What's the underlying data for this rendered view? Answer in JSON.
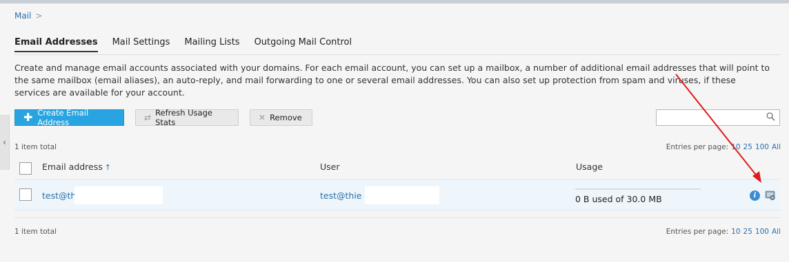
{
  "breadcrumb": {
    "root": "Mail",
    "sep": ">"
  },
  "tabs": [
    {
      "label": "Email Addresses",
      "active": true
    },
    {
      "label": "Mail Settings"
    },
    {
      "label": "Mailing Lists"
    },
    {
      "label": "Outgoing Mail Control"
    }
  ],
  "description": "Create and manage email accounts associated with your domains. For each email account, you can set up a mailbox, a number of additional email addresses that will point to the same mailbox (email aliases), an auto-reply, and mail forwarding to one or several email addresses. You can also set up protection from spam and viruses, if these services are available for your account.",
  "toolbar": {
    "create_label": "Create Email Address",
    "refresh_label": "Refresh Usage Stats",
    "remove_label": "Remove"
  },
  "search": {
    "placeholder": ""
  },
  "summary": {
    "total_top": "1 item total",
    "total_bottom": "1 item total",
    "entries_label": "Entries per page:",
    "page_sizes": [
      "10",
      "25",
      "100",
      "All"
    ]
  },
  "table": {
    "columns": {
      "email": "Email address",
      "user": "User",
      "usage": "Usage"
    },
    "sort_indicator": "↑",
    "rows": [
      {
        "email": "test@th",
        "user": "test@thie",
        "usage": "0 B used of 30.0 MB",
        "usage_fraction": 0.0
      }
    ]
  },
  "colors": {
    "accent": "#28a4e0",
    "link": "#2b6fa8",
    "annotation_arrow": "#e01b1b",
    "row_highlight": "#eef6fb"
  },
  "icons": {
    "create": "plus-icon",
    "refresh": "refresh-icon",
    "remove": "x-icon",
    "search": "search-icon",
    "info": "info-icon",
    "settings": "gear-icon"
  }
}
